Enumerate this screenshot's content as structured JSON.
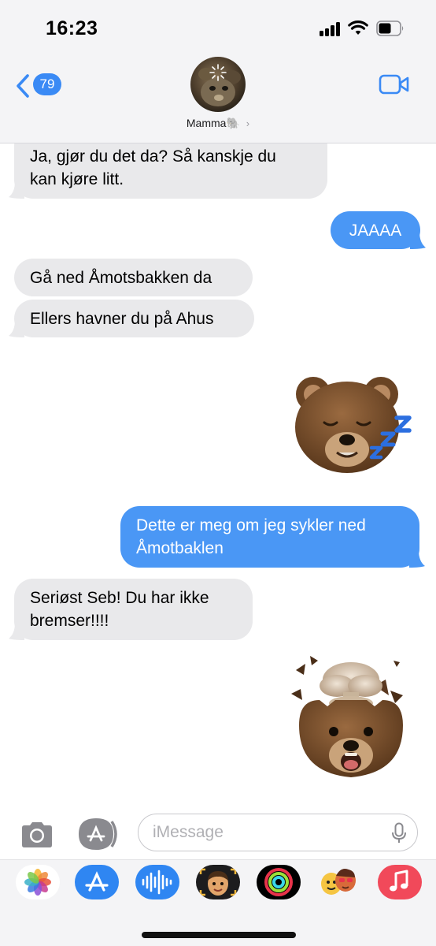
{
  "status_bar": {
    "time": "16:23"
  },
  "header": {
    "unread_count": "79",
    "contact_name": "Mamma",
    "contact_emoji": "🐘"
  },
  "messages": [
    {
      "direction": "incoming",
      "text": "Ja, gjør du det da? Så kanskje du\nkan kjøre litt."
    },
    {
      "direction": "outgoing",
      "text": "JAAAA"
    },
    {
      "direction": "incoming",
      "text": "Gå ned Åmotsbakken da"
    },
    {
      "direction": "incoming",
      "text": "Ellers havner du på Ahus"
    },
    {
      "direction": "outgoing",
      "type": "animoji",
      "icon": "sleeping-bear-memoji"
    },
    {
      "direction": "outgoing",
      "text": "Dette er meg om jeg sykler ned\nÅmotbaklen"
    },
    {
      "direction": "incoming",
      "text": "Seriøst Seb! Du har ikke\nbremser!!!!"
    },
    {
      "direction": "outgoing",
      "type": "animoji",
      "icon": "exploding-head-bear-memoji"
    }
  ],
  "input": {
    "placeholder": "iMessage"
  },
  "app_drawer": [
    "photos-app-icon",
    "app-store-icon",
    "audio-message-icon",
    "memoji-stickers-icon",
    "activity-icon",
    "animoji-icon",
    "music-icon"
  ],
  "colors": {
    "outgoing_bubble": "#4a97f5",
    "incoming_bubble": "#e9e9eb",
    "accent": "#3a8af5"
  }
}
